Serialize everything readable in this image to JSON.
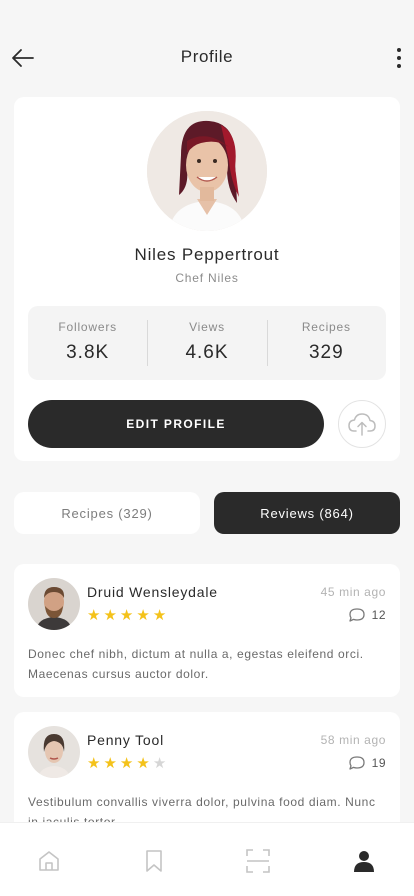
{
  "header": {
    "title": "Profile",
    "back_icon": "arrow-left-icon",
    "menu_icon": "more-vertical-icon"
  },
  "profile": {
    "name": "Niles Peppertrout",
    "role": "Chef Niles",
    "stats": [
      {
        "label": "Followers",
        "value": "3.8K"
      },
      {
        "label": "Views",
        "value": "4.6K"
      },
      {
        "label": "Recipes",
        "value": "329"
      }
    ],
    "edit_button": "EDIT PROFILE",
    "upload_icon": "cloud-upload-icon"
  },
  "tabs": [
    {
      "label": "Recipes (329)",
      "active": false
    },
    {
      "label": "Reviews (864)",
      "active": true
    }
  ],
  "reviews": [
    {
      "name": "Druid Wensleydale",
      "time": "45 min ago",
      "rating": 5,
      "comments": "12",
      "text": "Donec chef nibh, dictum at nulla a, egestas eleifend orci. Maecenas cursus auctor dolor."
    },
    {
      "name": "Penny Tool",
      "time": "58 min ago",
      "rating": 4,
      "comments": "19",
      "text": "Vestibulum convallis viverra dolor, pulvina food diam. Nunc in iaculis tortor."
    }
  ],
  "bottom_nav": [
    {
      "icon": "home-icon",
      "active": false
    },
    {
      "icon": "bookmark-icon",
      "active": false
    },
    {
      "icon": "scan-icon",
      "active": false
    },
    {
      "icon": "user-icon",
      "active": true
    }
  ],
  "colors": {
    "dark": "#2a2a2a",
    "star": "#f4c21a",
    "background": "#f6f6f6"
  }
}
